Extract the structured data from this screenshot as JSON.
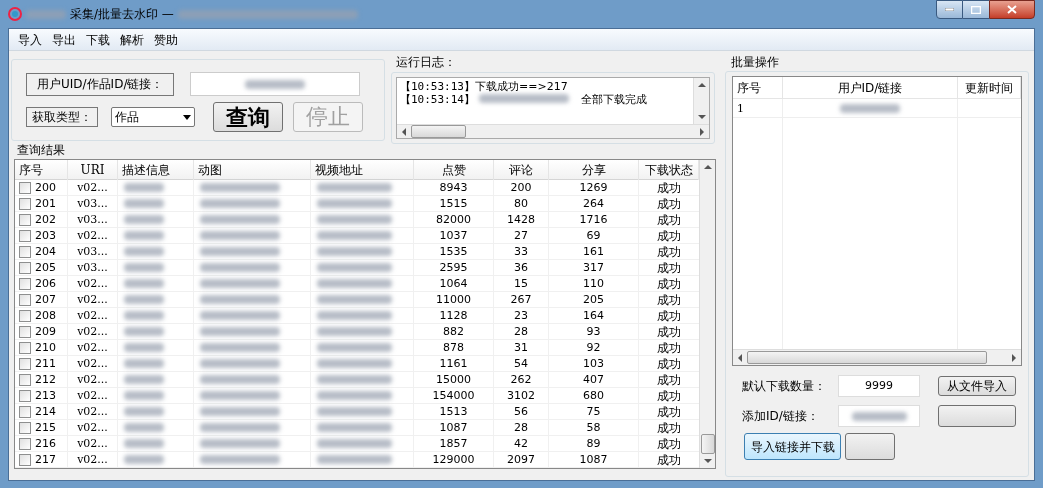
{
  "window": {
    "title": "采集/批量去水印 —"
  },
  "menu": [
    "导入",
    "导出",
    "下载",
    "解析",
    "赞助"
  ],
  "query": {
    "uid_label": "用户UID/作品ID/链接：",
    "type_label": "获取类型：",
    "type_value": "作品",
    "query_button": "查询",
    "stop_button": {
      "label": "停止",
      "disabled": true
    }
  },
  "log": {
    "title": "运行日志：",
    "lines": [
      {
        "time": "【10:53:13】",
        "message": "下载成功==>217"
      },
      {
        "time": "【10:53:14】",
        "message": "全部下载完成"
      }
    ]
  },
  "results": {
    "title": "查询结果",
    "columns": [
      "序号",
      "URI",
      "描述信息",
      "动图",
      "视频地址",
      "点赞",
      "评论",
      "分享",
      "下载状态"
    ],
    "rows": [
      {
        "checked": false,
        "index": "200",
        "uri": "v02...",
        "likes": "8943",
        "comments": "200",
        "shares": "1269",
        "status": "成功"
      },
      {
        "checked": false,
        "index": "201",
        "uri": "v03...",
        "likes": "1515",
        "comments": "80",
        "shares": "264",
        "status": "成功"
      },
      {
        "checked": false,
        "index": "202",
        "uri": "v03...",
        "likes": "82000",
        "comments": "1428",
        "shares": "1716",
        "status": "成功"
      },
      {
        "checked": false,
        "index": "203",
        "uri": "v02...",
        "likes": "1037",
        "comments": "27",
        "shares": "69",
        "status": "成功"
      },
      {
        "checked": false,
        "index": "204",
        "uri": "v03...",
        "likes": "1535",
        "comments": "33",
        "shares": "161",
        "status": "成功"
      },
      {
        "checked": false,
        "index": "205",
        "uri": "v03...",
        "likes": "2595",
        "comments": "36",
        "shares": "317",
        "status": "成功"
      },
      {
        "checked": false,
        "index": "206",
        "uri": "v02...",
        "likes": "1064",
        "comments": "15",
        "shares": "110",
        "status": "成功"
      },
      {
        "checked": false,
        "index": "207",
        "uri": "v02...",
        "likes": "11000",
        "comments": "267",
        "shares": "205",
        "status": "成功"
      },
      {
        "checked": false,
        "index": "208",
        "uri": "v02...",
        "likes": "1128",
        "comments": "23",
        "shares": "164",
        "status": "成功"
      },
      {
        "checked": false,
        "index": "209",
        "uri": "v02...",
        "likes": "882",
        "comments": "28",
        "shares": "93",
        "status": "成功"
      },
      {
        "checked": false,
        "index": "210",
        "uri": "v02...",
        "likes": "878",
        "comments": "31",
        "shares": "92",
        "status": "成功"
      },
      {
        "checked": false,
        "index": "211",
        "uri": "v02...",
        "likes": "1161",
        "comments": "54",
        "shares": "103",
        "status": "成功"
      },
      {
        "checked": false,
        "index": "212",
        "uri": "v02...",
        "likes": "15000",
        "comments": "262",
        "shares": "407",
        "status": "成功"
      },
      {
        "checked": false,
        "index": "213",
        "uri": "v02...",
        "likes": "154000",
        "comments": "3102",
        "shares": "680",
        "status": "成功"
      },
      {
        "checked": false,
        "index": "214",
        "uri": "v02...",
        "likes": "1513",
        "comments": "56",
        "shares": "75",
        "status": "成功"
      },
      {
        "checked": false,
        "index": "215",
        "uri": "v02...",
        "likes": "1087",
        "comments": "28",
        "shares": "58",
        "status": "成功"
      },
      {
        "checked": false,
        "index": "216",
        "uri": "v02...",
        "likes": "1857",
        "comments": "42",
        "shares": "89",
        "status": "成功"
      },
      {
        "checked": false,
        "index": "217",
        "uri": "v02...",
        "likes": "129000",
        "comments": "2097",
        "shares": "1087",
        "status": "成功"
      }
    ]
  },
  "batch": {
    "title": "批量操作",
    "columns": [
      "序号",
      "用户ID/链接",
      "更新时间"
    ],
    "rows": [
      {
        "index": "1"
      }
    ],
    "count_label": "默认下载数量：",
    "count_value": "9999",
    "import_file_button": "从文件导入",
    "add_label": "添加ID/链接：",
    "import_download_button": "导入链接并下载"
  }
}
